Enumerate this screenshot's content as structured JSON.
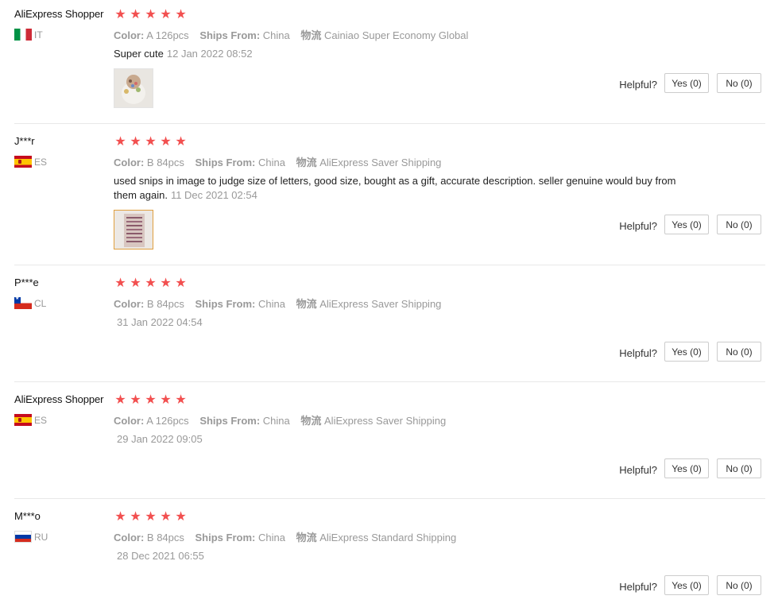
{
  "labels": {
    "color": "Color:",
    "ships_from": "Ships From:",
    "logistics": "物流",
    "helpful": "Helpful?",
    "star_glyph": "★"
  },
  "reviews": [
    {
      "user": "AliExpress Shopper",
      "country": "IT",
      "flag": "it",
      "stars": 5,
      "color_value": "A 126pcs",
      "ships_from": "China",
      "logistics": "Cainiao Super Economy Global",
      "text": "Super cute",
      "date": "12 Jan 2022 08:52",
      "has_image": true,
      "yes_label": "Yes (0)",
      "no_label": "No (0)"
    },
    {
      "user": "J***r",
      "country": "ES",
      "flag": "es",
      "stars": 5,
      "color_value": "B 84pcs",
      "ships_from": "China",
      "logistics": "AliExpress Saver Shipping",
      "text": "used snips in image to judge size of letters, good size, bought as a gift, accurate description. seller genuine would buy from them again.",
      "date": "11 Dec 2021 02:54",
      "has_image": true,
      "yes_label": "Yes (0)",
      "no_label": "No (0)"
    },
    {
      "user": "P***e",
      "country": "CL",
      "flag": "cl",
      "stars": 5,
      "color_value": "B 84pcs",
      "ships_from": "China",
      "logistics": "AliExpress Saver Shipping",
      "text": "",
      "date": "31 Jan 2022 04:54",
      "has_image": false,
      "yes_label": "Yes (0)",
      "no_label": "No (0)"
    },
    {
      "user": "AliExpress Shopper",
      "country": "ES",
      "flag": "es",
      "stars": 5,
      "color_value": "A 126pcs",
      "ships_from": "China",
      "logistics": "AliExpress Saver Shipping",
      "text": "",
      "date": "29 Jan 2022 09:05",
      "has_image": false,
      "yes_label": "Yes (0)",
      "no_label": "No (0)"
    },
    {
      "user": "M***o",
      "country": "RU",
      "flag": "ru",
      "stars": 5,
      "color_value": "B 84pcs",
      "ships_from": "China",
      "logistics": "AliExpress Standard Shipping",
      "text": "",
      "date": "28 Dec 2021 06:55",
      "has_image": false,
      "yes_label": "Yes (0)",
      "no_label": "No (0)"
    }
  ]
}
